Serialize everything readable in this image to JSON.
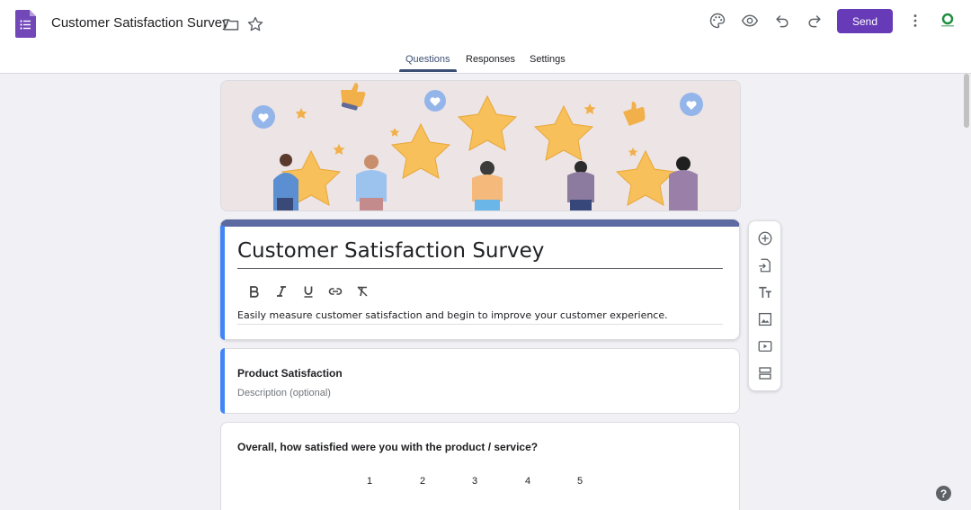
{
  "header": {
    "doc_title": "Customer Satisfaction Survey",
    "send_label": "Send",
    "icons": [
      "folder-icon",
      "star-icon",
      "palette-icon",
      "preview-icon",
      "undo-icon",
      "redo-icon",
      "more-icon"
    ]
  },
  "tabs": [
    {
      "label": "Questions",
      "active": true
    },
    {
      "label": "Responses",
      "active": false
    },
    {
      "label": "Settings",
      "active": false
    }
  ],
  "form": {
    "title": "Customer Satisfaction Survey",
    "description": "Easily measure customer satisfaction and begin to improve your customer experience."
  },
  "section": {
    "title": "Product Satisfaction",
    "description": "Description (optional)"
  },
  "question": {
    "text": "Overall, how satisfied were you with the product / service?",
    "scale": [
      "1",
      "2",
      "3",
      "4",
      "5"
    ]
  },
  "side_toolbar": [
    "add-question-icon",
    "import-questions-icon",
    "add-title-icon",
    "add-image-icon",
    "add-video-icon",
    "add-section-icon"
  ],
  "help_label": "?",
  "colors": {
    "accent": "#673ab7",
    "header_stripe": "#5d6aa1",
    "left_bar": "#4285f4",
    "background": "#f1f0f5"
  }
}
